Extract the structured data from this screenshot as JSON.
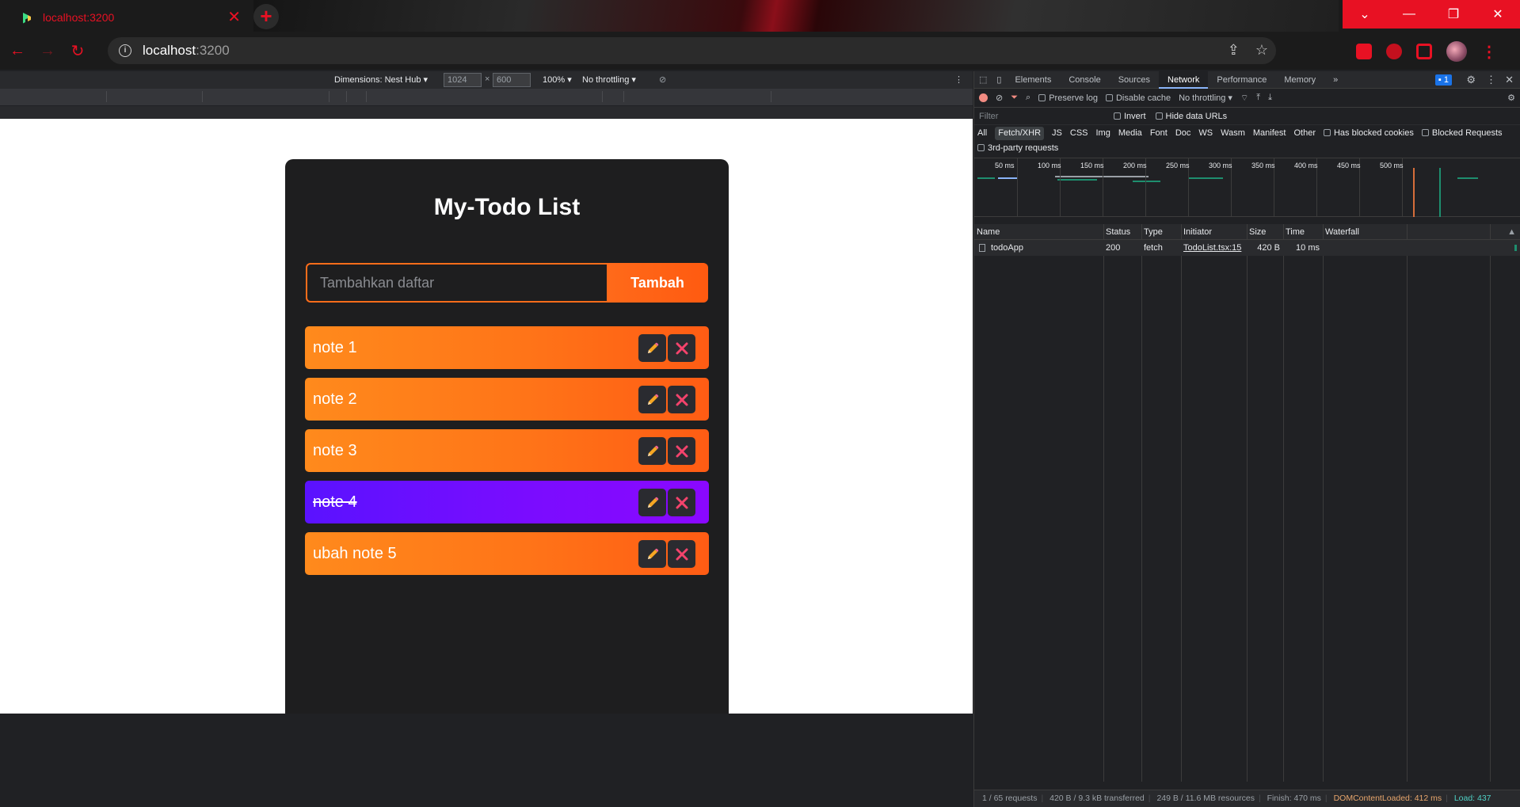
{
  "browser": {
    "tab_title": "localhost:3200",
    "omnibox_host": "localhost",
    "omnibox_port": ":3200",
    "accent_color": "#e81123"
  },
  "device_toolbar": {
    "dimensions_label": "Dimensions: Nest Hub",
    "width_value": "1024",
    "times": "×",
    "height_value": "600",
    "zoom": "100%",
    "throttling": "No throttling"
  },
  "app": {
    "title": "My-Todo List",
    "input_placeholder": "Tambahkan daftar",
    "add_button_label": "Tambah",
    "todos": [
      {
        "text": "note 1",
        "done": false
      },
      {
        "text": "note 2",
        "done": false
      },
      {
        "text": "note 3",
        "done": false
      },
      {
        "text": "note 4",
        "done": true
      },
      {
        "text": "ubah note 5",
        "done": false
      }
    ],
    "colors": {
      "active_item": "#ff7418",
      "done_item": "#7a0cff",
      "card": "#1e1e1f"
    }
  },
  "devtools": {
    "tabs": [
      "Elements",
      "Console",
      "Sources",
      "Network",
      "Performance",
      "Memory"
    ],
    "active_tab": "Network",
    "issues_count": "1",
    "toolbar": {
      "preserve_log": "Preserve log",
      "disable_cache": "Disable cache",
      "throttling": "No throttling"
    },
    "filter_placeholder": "Filter",
    "invert": "Invert",
    "hide_data_urls": "Hide data URLs",
    "types": [
      "All",
      "Fetch/XHR",
      "JS",
      "CSS",
      "Img",
      "Media",
      "Font",
      "Doc",
      "WS",
      "Wasm",
      "Manifest",
      "Other"
    ],
    "active_type": "Fetch/XHR",
    "has_blocked_cookies": "Has blocked cookies",
    "blocked_requests": "Blocked Requests",
    "third_party": "3rd-party requests",
    "timeline_labels": [
      "50 ms",
      "100 ms",
      "150 ms",
      "200 ms",
      "250 ms",
      "300 ms",
      "350 ms",
      "400 ms",
      "450 ms",
      "500 ms"
    ],
    "columns": [
      "Name",
      "Status",
      "Type",
      "Initiator",
      "Size",
      "Time",
      "Waterfall"
    ],
    "rows": [
      {
        "name": "todoApp",
        "status": "200",
        "type": "fetch",
        "initiator": "TodoList.tsx:15",
        "size": "420 B",
        "time": "10 ms"
      }
    ],
    "status_bar": {
      "requests": "1 / 65 requests",
      "transferred": "420 B / 9.3 kB transferred",
      "resources": "249 B / 11.6 MB resources",
      "finish": "Finish: 470 ms",
      "dom_loaded": "DOMContentLoaded: 412 ms",
      "load": "Load: 437"
    }
  }
}
